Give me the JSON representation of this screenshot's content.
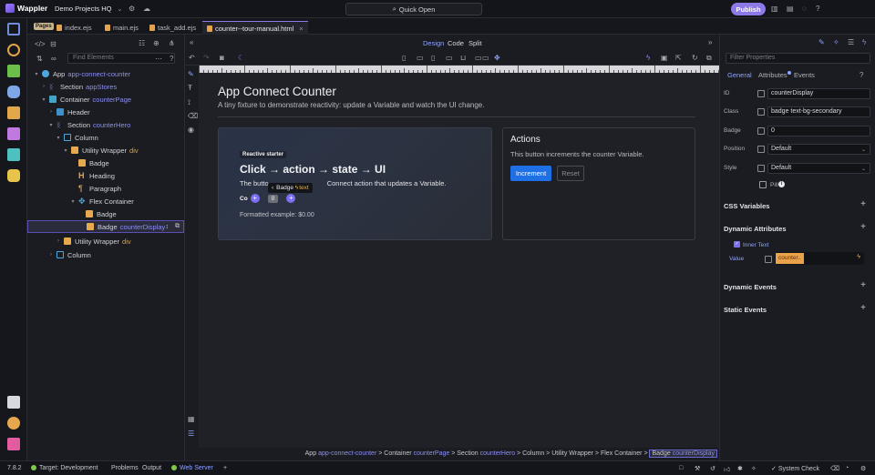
{
  "app": {
    "name": "Wappler",
    "project": "Demo Projects HQ",
    "quick_open": "Quick Open",
    "publish": "Publish"
  },
  "tabs": {
    "pages_tag": "Pages",
    "items": [
      "index.ejs",
      "main.ejs",
      "task_add.ejs",
      "counter--tour-manual.html"
    ]
  },
  "left": {
    "search_placeholder": "Find Elements",
    "tree": [
      {
        "label": "App",
        "sub": "app-connect-counter"
      },
      {
        "label": "Section",
        "sub": "appStores"
      },
      {
        "label": "Container",
        "sub": "counterPage"
      },
      {
        "label": "Header",
        "sub": ""
      },
      {
        "label": "Section",
        "sub": "counterHero"
      },
      {
        "label": "Column",
        "sub": ""
      },
      {
        "label": "Utility Wrapper",
        "sub": "div"
      },
      {
        "label": "Badge",
        "sub": ""
      },
      {
        "label": "Heading",
        "sub": ""
      },
      {
        "label": "Paragraph",
        "sub": ""
      },
      {
        "label": "Flex Container",
        "sub": ""
      },
      {
        "label": "Badge",
        "sub": ""
      },
      {
        "label": "Badge",
        "sub": "counterDisplay"
      },
      {
        "label": "Utility Wrapper",
        "sub": "div"
      },
      {
        "label": "Column",
        "sub": ""
      }
    ]
  },
  "center": {
    "modes": [
      "Design",
      "Code",
      "Split"
    ],
    "page_title": "App Connect Counter",
    "page_lead": "A tiny fixture to demonstrate reactivity: update a Variable and watch the UI change.",
    "hero": {
      "badge": "Reactive starter",
      "heading": "Click → action → state → UI",
      "paragraph_start": "The butto",
      "paragraph_end": "Connect action that updates a Variable.",
      "tooltip": "Badge",
      "tooltip_extra": "text",
      "count_label": "Co",
      "count_value": "0",
      "formatted": "Formatted example: $0.00"
    },
    "actions": {
      "title": "Actions",
      "text": "This button increments the counter Variable.",
      "increment": "Increment",
      "reset": "Reset"
    },
    "breadcrumb": [
      {
        "label": "App",
        "sub": "app-connect-counter"
      },
      {
        "label": "Container",
        "sub": "counterPage"
      },
      {
        "label": "Section",
        "sub": "counterHero"
      },
      {
        "label": "Column",
        "sub": ""
      },
      {
        "label": "Utility Wrapper",
        "sub": ""
      },
      {
        "label": "Flex Container",
        "sub": ""
      },
      {
        "label": "Badge",
        "sub": "counterDisplay"
      }
    ]
  },
  "right": {
    "filter_placeholder": "Filter Properties",
    "tabs": [
      "General",
      "Attributes",
      "Events"
    ],
    "props": {
      "id_label": "ID",
      "id_value": "counterDisplay",
      "class_label": "Class",
      "class_value": "badge text-bg-secondary",
      "badge_label": "Badge",
      "badge_value": "0",
      "position_label": "Position",
      "position_value": "Default",
      "style_label": "Style",
      "style_value": "Default",
      "pill_label": "Pill"
    },
    "sections": {
      "css_vars": "CSS Variables",
      "dyn_attrs": "Dynamic Attributes",
      "inner_text": "Inner Text",
      "value_label": "Value",
      "value": "counter..",
      "dyn_events": "Dynamic Events",
      "static_events": "Static Events"
    }
  },
  "status": {
    "version": "7.8.2",
    "target": "Target:  Development",
    "problems": "Problems",
    "output": "Output",
    "web_server": "Web Server",
    "system_check": "System Check"
  },
  "colors": {
    "accent": "#8e79e8",
    "primary_button": "#1f6fe5",
    "link_sub": "#8d8ff0"
  }
}
